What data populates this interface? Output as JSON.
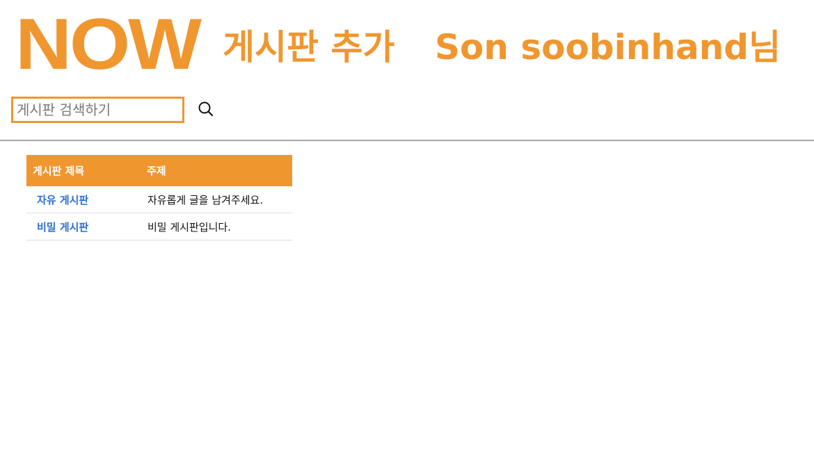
{
  "header": {
    "logo_text": "NOW",
    "add_board_label": "게시판 추가",
    "user_label": "Son soobinhand님"
  },
  "search": {
    "placeholder": "게시판 검색하기",
    "value": "",
    "icon": "search-icon"
  },
  "board_table": {
    "columns": [
      "게시판 제목",
      "주제"
    ],
    "rows": [
      {
        "name": "자유 게시판",
        "topic": "자유롭게 글을 남겨주세요."
      },
      {
        "name": "비밀 게시판",
        "topic": "비밀 게시판입니다."
      }
    ]
  },
  "colors": {
    "accent": "#f0962f",
    "link": "#2b6fd6",
    "divider": "#a6a6a6"
  }
}
